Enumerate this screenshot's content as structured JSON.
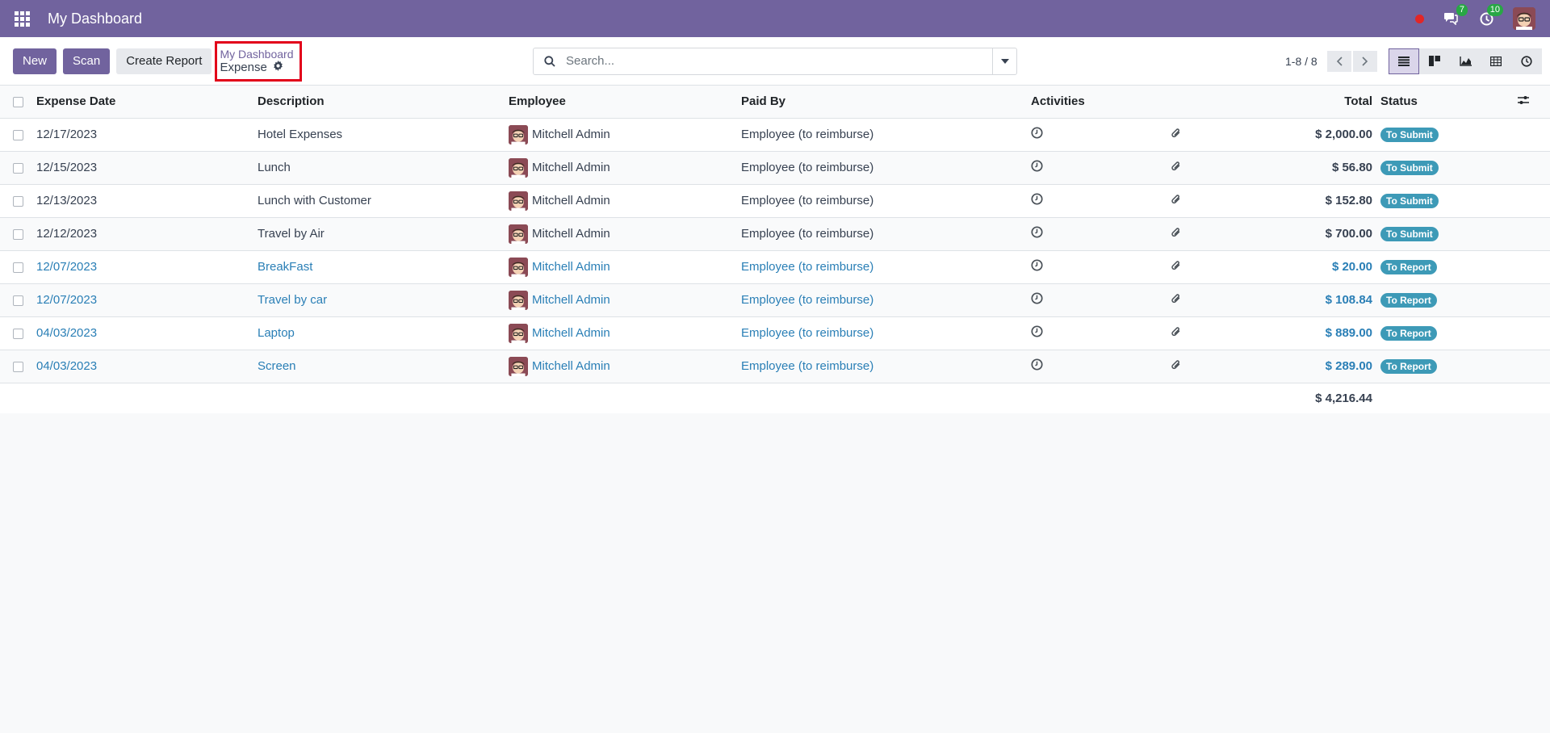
{
  "navbar": {
    "title": "My Dashboard",
    "messages_count": "7",
    "activities_count": "10"
  },
  "control": {
    "new_label": "New",
    "scan_label": "Scan",
    "create_report_label": "Create Report",
    "breadcrumb_parent": "My Dashboard",
    "breadcrumb_current": "Expense",
    "search_placeholder": "Search...",
    "pager": "1-8 / 8"
  },
  "table": {
    "headers": {
      "date": "Expense Date",
      "description": "Description",
      "employee": "Employee",
      "paid_by": "Paid By",
      "activities": "Activities",
      "total": "Total",
      "status": "Status"
    },
    "rows": [
      {
        "date": "12/17/2023",
        "description": "Hotel Expenses",
        "employee": "Mitchell Admin",
        "paid_by": "Employee (to reimburse)",
        "total": "$ 2,000.00",
        "status": "To Submit"
      },
      {
        "date": "12/15/2023",
        "description": "Lunch",
        "employee": "Mitchell Admin",
        "paid_by": "Employee (to reimburse)",
        "total": "$ 56.80",
        "status": "To Submit"
      },
      {
        "date": "12/13/2023",
        "description": "Lunch with Customer",
        "employee": "Mitchell Admin",
        "paid_by": "Employee (to reimburse)",
        "total": "$ 152.80",
        "status": "To Submit"
      },
      {
        "date": "12/12/2023",
        "description": "Travel by Air",
        "employee": "Mitchell Admin",
        "paid_by": "Employee (to reimburse)",
        "total": "$ 700.00",
        "status": "To Submit"
      },
      {
        "date": "12/07/2023",
        "description": "BreakFast",
        "employee": "Mitchell Admin",
        "paid_by": "Employee (to reimburse)",
        "total": "$ 20.00",
        "status": "To Report"
      },
      {
        "date": "12/07/2023",
        "description": "Travel by car",
        "employee": "Mitchell Admin",
        "paid_by": "Employee (to reimburse)",
        "total": "$ 108.84",
        "status": "To Report"
      },
      {
        "date": "04/03/2023",
        "description": "Laptop",
        "employee": "Mitchell Admin",
        "paid_by": "Employee (to reimburse)",
        "total": "$ 889.00",
        "status": "To Report"
      },
      {
        "date": "04/03/2023",
        "description": "Screen",
        "employee": "Mitchell Admin",
        "paid_by": "Employee (to reimburse)",
        "total": "$ 289.00",
        "status": "To Report"
      }
    ],
    "grand_total": "$ 4,216.44"
  },
  "colors": {
    "brand": "#71639e",
    "status_badge": "#3d9ab7",
    "link": "#2a7fb6",
    "highlight_border": "#e2001a"
  }
}
